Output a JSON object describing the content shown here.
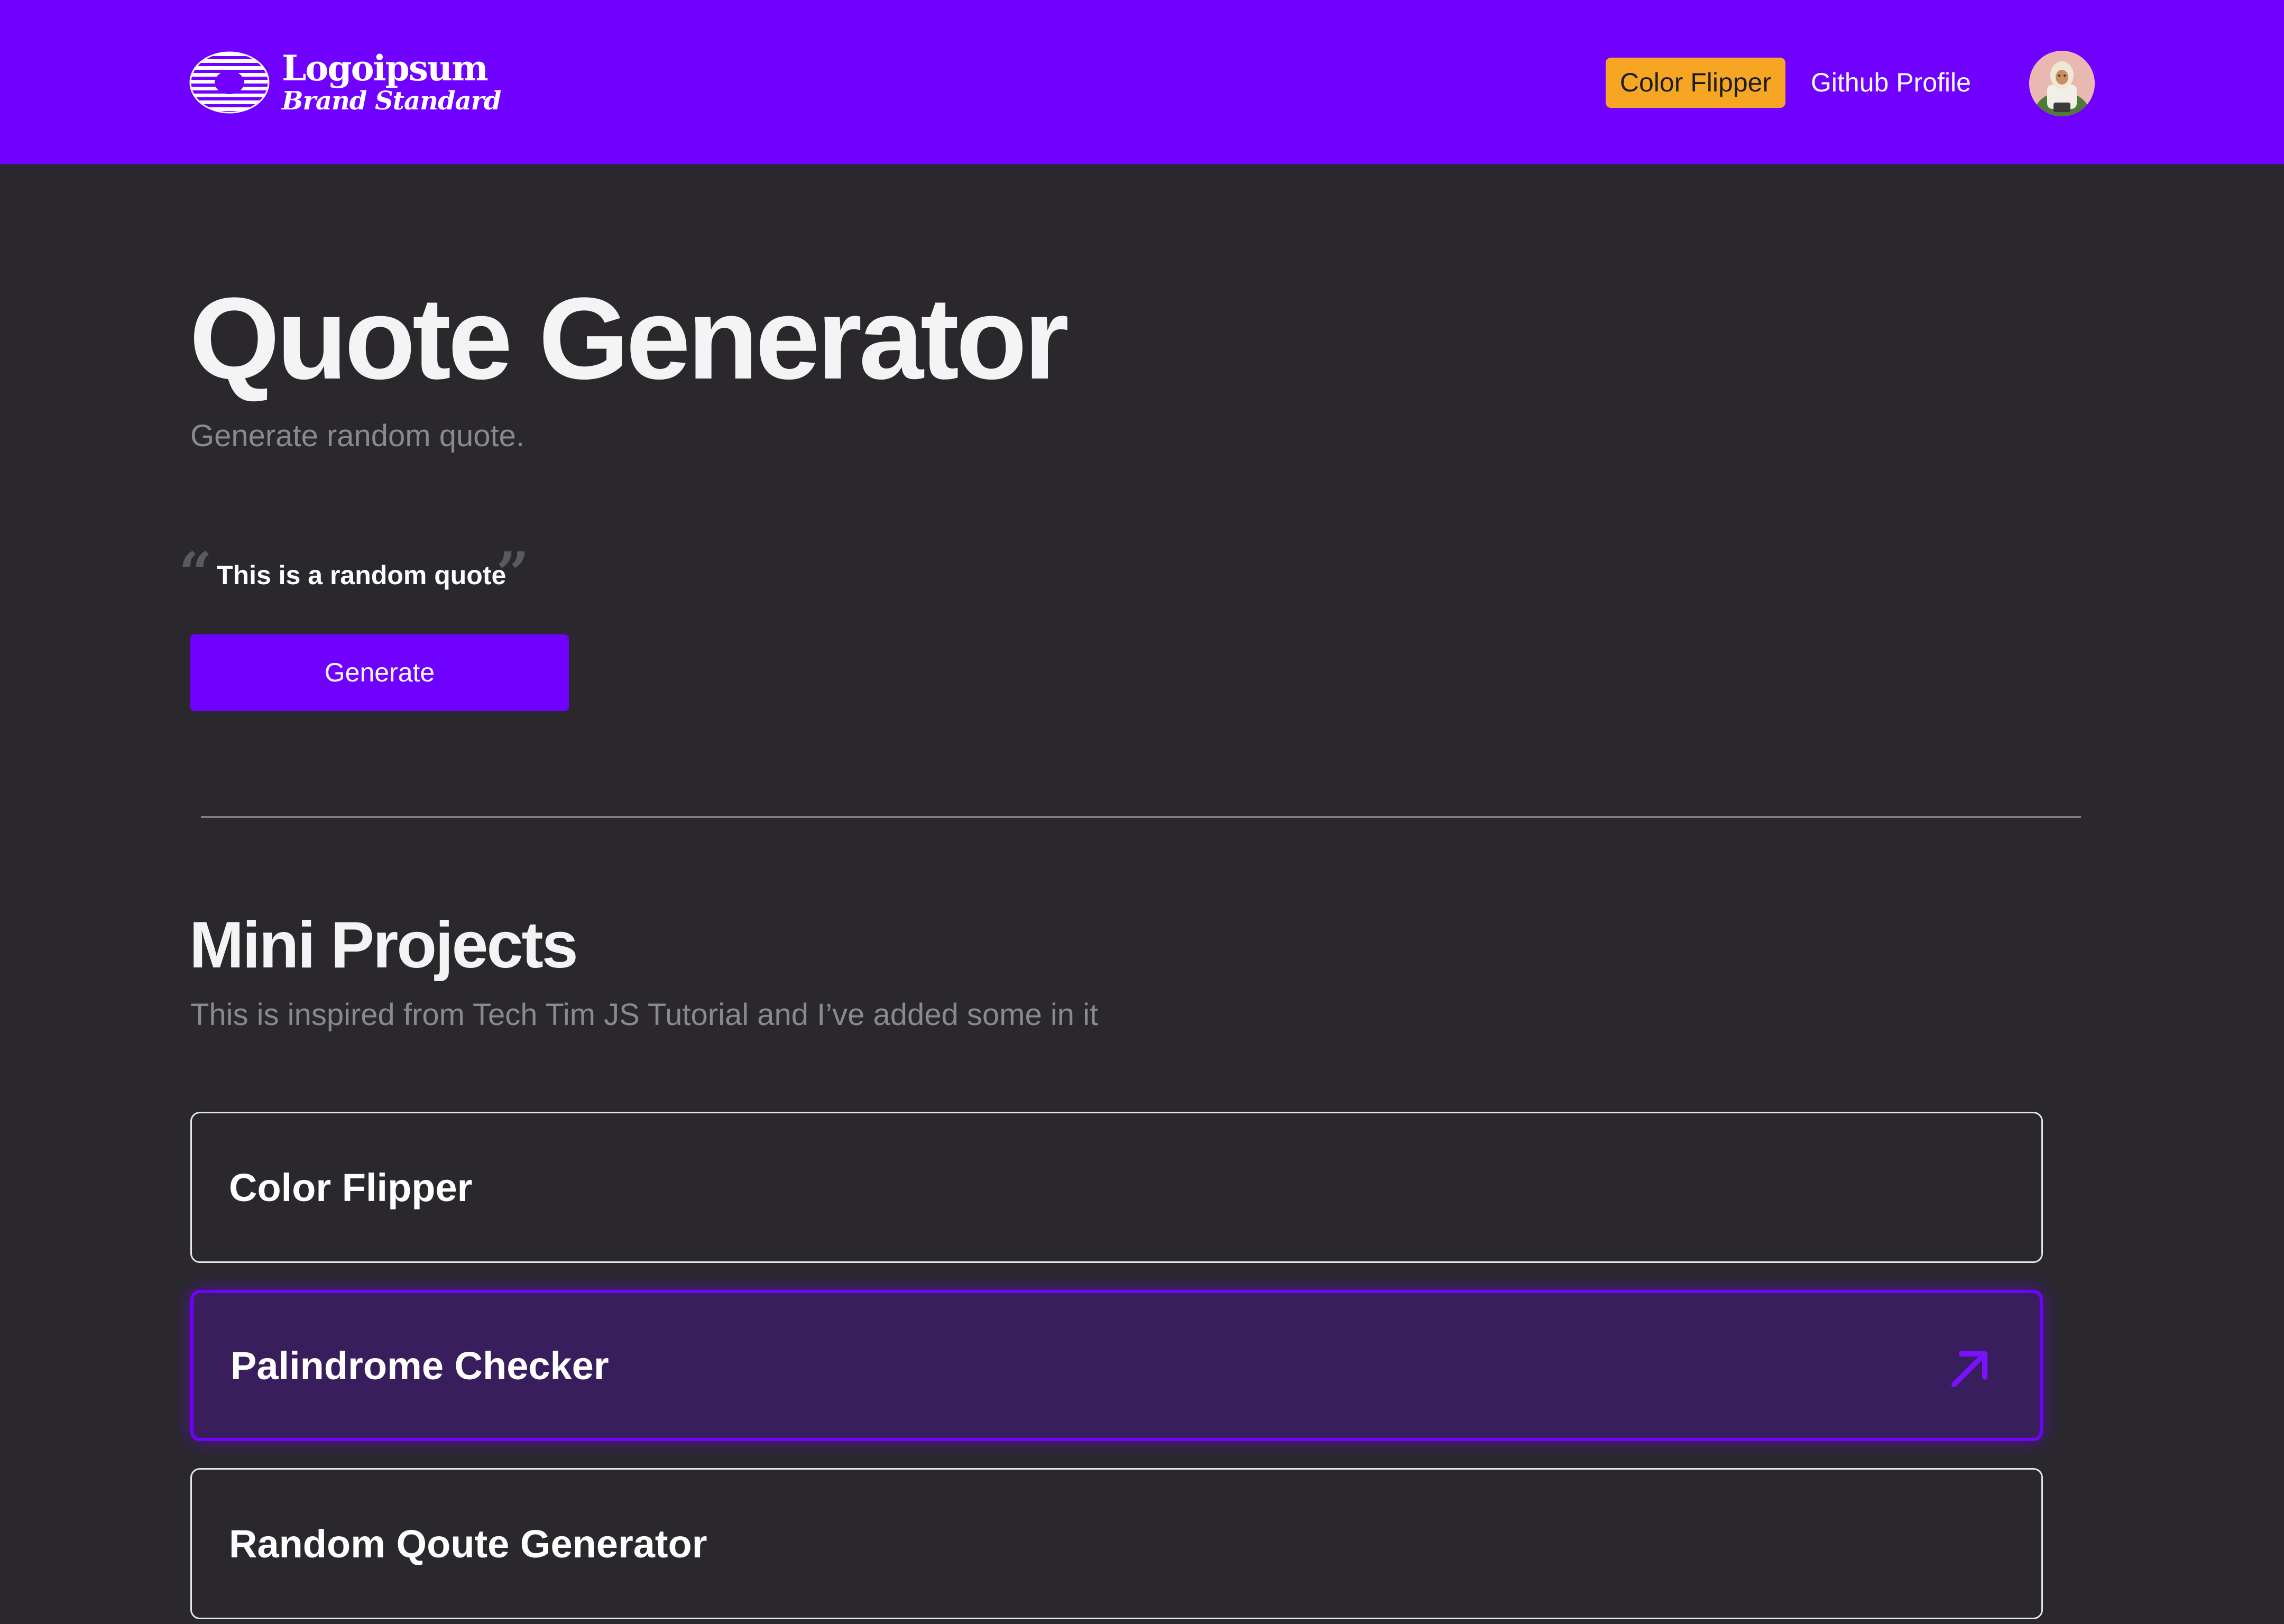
{
  "header": {
    "logo_name": "Logoipsum",
    "logo_tagline": "Brand Standard",
    "nav_button_label": "Color Flipper",
    "nav_link_label": "Github Profile",
    "avatar_icon": "user-avatar",
    "colors": {
      "header_bg": "#7000ff",
      "button_bg": "#f6a623"
    }
  },
  "hero": {
    "title": "Quote Generator",
    "subtitle": "Generate random quote.",
    "quote_open": "“",
    "quote_text": "This is a random quote",
    "quote_close": "”",
    "generate_label": "Generate"
  },
  "mini_projects": {
    "title": "Mini Projects",
    "subtitle": "This is inspired from Tech Tim JS Tutorial and I’ve added some in it",
    "items": [
      {
        "label": "Color Flipper",
        "active": false
      },
      {
        "label": "Palindrome Checker",
        "active": true,
        "icon": "arrow-up-right-icon"
      },
      {
        "label": "Random Qoute Generator",
        "active": false
      }
    ]
  },
  "colors": {
    "accent": "#7000ff",
    "background": "#2a282c",
    "active_card_bg": "#381e5c",
    "muted_text": "#8a8a8e"
  }
}
